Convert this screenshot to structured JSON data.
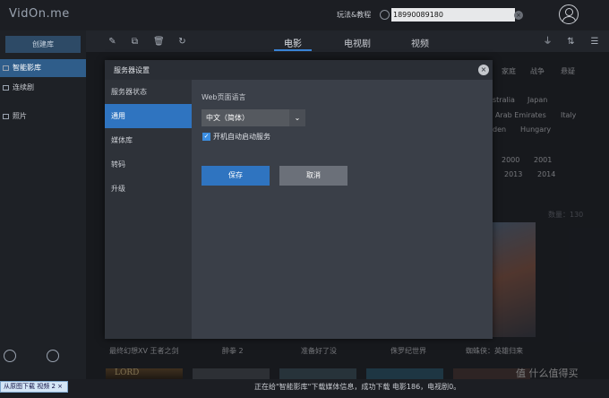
{
  "app": {
    "logo": "VidOn.me",
    "help_link": "玩法&教程",
    "search_value": "18990089180"
  },
  "sidebar": {
    "create_label": "创建库",
    "items": [
      {
        "label": "智能影库"
      },
      {
        "label": "连续剧"
      },
      {
        "label": "照片"
      }
    ]
  },
  "tabs": [
    {
      "label": "电影"
    },
    {
      "label": "电视剧"
    },
    {
      "label": "视频"
    }
  ],
  "filters": {
    "genres": [
      "家庭",
      "战争",
      "悬疑"
    ],
    "countries": [
      "stralia",
      "Japan",
      "Arab Emirates",
      "Italy",
      "den",
      "Hungary"
    ],
    "years": [
      "2000",
      "2001",
      "2013",
      "2014"
    ]
  },
  "count_label": "数量：130",
  "movies": [
    {
      "title": "最终幻想XV 王者之剑"
    },
    {
      "title": "醉拳 2"
    },
    {
      "title": "准备好了没"
    },
    {
      "title": "侏罗纪世界"
    },
    {
      "title": "蜘蛛侠：英雄归来"
    }
  ],
  "second_row_poster_text": "LORD",
  "status": "正在给\"智能影库\"下载媒体信息，成功下载 电影186，电视剧0。",
  "taskbar_chip": "从原图下载 视频 2 ×",
  "watermark": "值 什么值得买",
  "modal": {
    "title": "服务器设置",
    "nav": [
      {
        "label": "服务器状态"
      },
      {
        "label": "通用"
      },
      {
        "label": "媒体库"
      },
      {
        "label": "转码"
      },
      {
        "label": "升级"
      }
    ],
    "language_label": "Web页面语言",
    "language_value": "中文（简体）",
    "autostart_label": "开机自动启动服务",
    "autostart_checked": true,
    "save_label": "保存",
    "cancel_label": "取消"
  }
}
